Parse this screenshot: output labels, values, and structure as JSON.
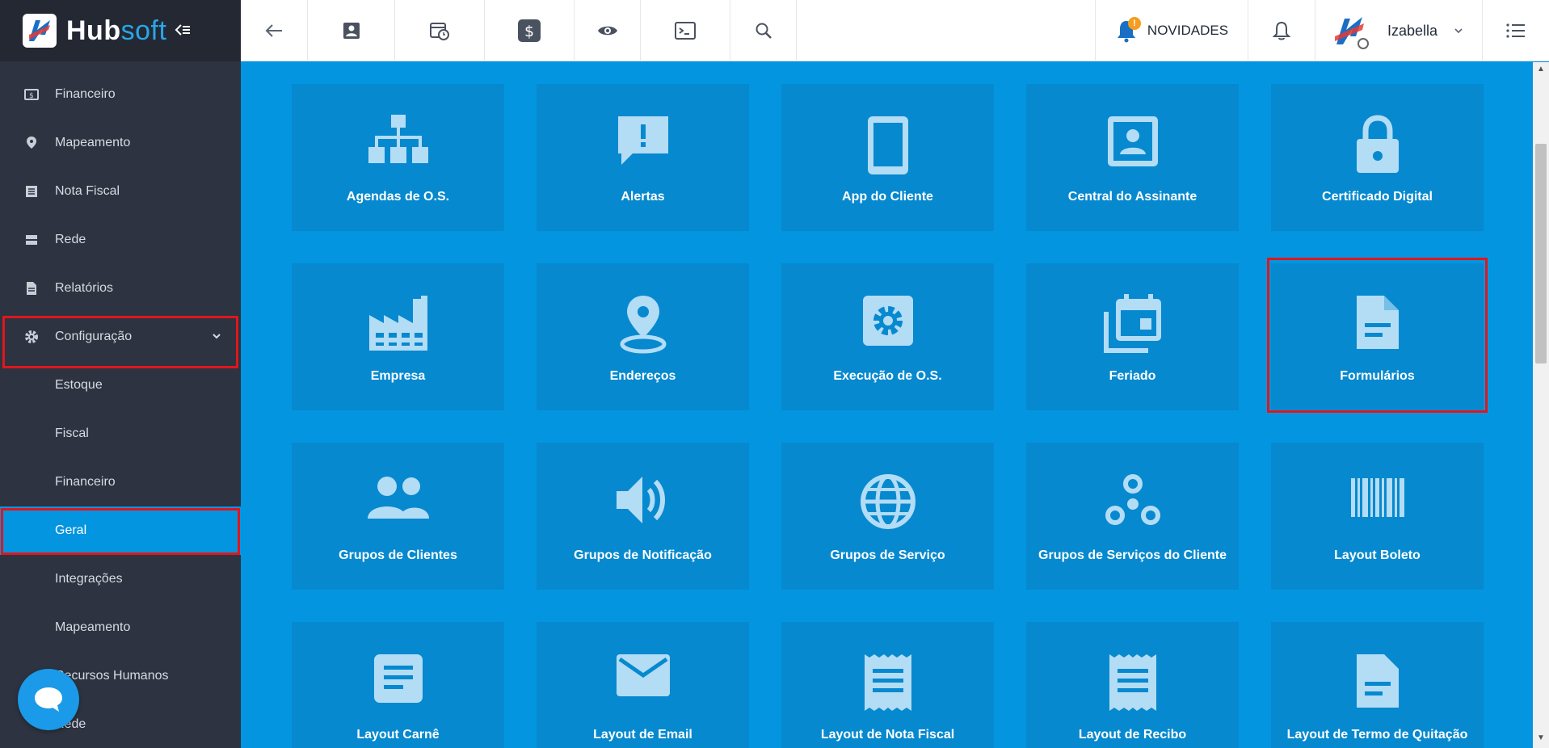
{
  "brand": {
    "name_part1": "Hub",
    "name_part2": "soft"
  },
  "sidebar": {
    "items": [
      {
        "label": "Financeiro"
      },
      {
        "label": "Mapeamento"
      },
      {
        "label": "Nota Fiscal"
      },
      {
        "label": "Rede"
      },
      {
        "label": "Relatórios"
      },
      {
        "label": "Configuração"
      }
    ],
    "subitems": [
      {
        "label": "Estoque"
      },
      {
        "label": "Fiscal"
      },
      {
        "label": "Financeiro"
      },
      {
        "label": "Geral"
      },
      {
        "label": "Integrações"
      },
      {
        "label": "Mapeamento"
      },
      {
        "label": "Recursos Humanos"
      },
      {
        "label": "Rede"
      }
    ]
  },
  "topbar": {
    "novidades_label": "NOVIDADES",
    "novidades_badge": "!",
    "user_name": "Izabella"
  },
  "tiles": [
    {
      "label": "Agendas de O.S.",
      "icon": "sitemap-icon"
    },
    {
      "label": "Alertas",
      "icon": "alert-message-icon"
    },
    {
      "label": "App do Cliente",
      "icon": "smartphone-icon"
    },
    {
      "label": "Central do Assinante",
      "icon": "portrait-icon"
    },
    {
      "label": "Certificado Digital",
      "icon": "lock-icon"
    },
    {
      "label": "Empresa",
      "icon": "factory-icon"
    },
    {
      "label": "Endereços",
      "icon": "location-pin-icon"
    },
    {
      "label": "Execução de O.S.",
      "icon": "gear-box-icon"
    },
    {
      "label": "Feriado",
      "icon": "calendar-stack-icon"
    },
    {
      "label": "Formulários",
      "icon": "document-icon"
    },
    {
      "label": "Grupos de Clientes",
      "icon": "people-icon"
    },
    {
      "label": "Grupos de Notificação",
      "icon": "speaker-icon"
    },
    {
      "label": "Grupos de Serviço",
      "icon": "globe-icon"
    },
    {
      "label": "Grupos de Serviços do Cliente",
      "icon": "circles-icon"
    },
    {
      "label": "Layout Boleto",
      "icon": "barcode-icon"
    },
    {
      "label": "Layout Carnê",
      "icon": "note-icon"
    },
    {
      "label": "Layout de Email",
      "icon": "email-icon"
    },
    {
      "label": "Layout de Nota Fiscal",
      "icon": "receipt-icon"
    },
    {
      "label": "Layout de Recibo",
      "icon": "receipt-icon"
    },
    {
      "label": "Layout de Termo de Quitação",
      "icon": "document-icon"
    }
  ],
  "colors": {
    "accent": "#0395e0",
    "tile": "#0689cf",
    "icon": "#b3dcf5",
    "highlight": "#e0161d",
    "sidebar": "#2d3340"
  }
}
